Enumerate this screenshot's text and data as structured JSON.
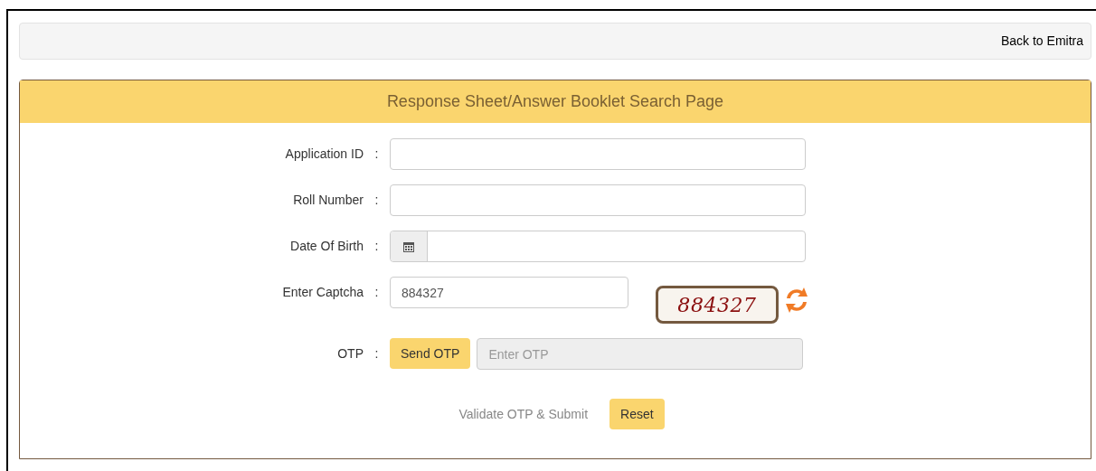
{
  "top_bar": {
    "link": "Back to Emitra"
  },
  "panel": {
    "title": "Response Sheet/Answer Booklet Search Page"
  },
  "fields": [
    {
      "kind": "text",
      "label": "Application ID",
      "separator": ":"
    },
    {
      "kind": "text",
      "label": "Roll Number",
      "separator": ":"
    },
    {
      "kind": "date",
      "label": "Date Of Birth",
      "separator": ":"
    },
    {
      "kind": "captcha",
      "label": "Enter Captcha",
      "separator": ":",
      "value": "884327",
      "captcha_text": "884327"
    },
    {
      "kind": "otp",
      "label": "OTP",
      "separator": ":",
      "button": "Send OTP",
      "placeholder": "Enter OTP",
      "disabled": true
    }
  ],
  "actions": [
    {
      "label": "Validate OTP & Submit",
      "disabled": true
    },
    {
      "label": "Reset",
      "disabled": false
    }
  ]
}
